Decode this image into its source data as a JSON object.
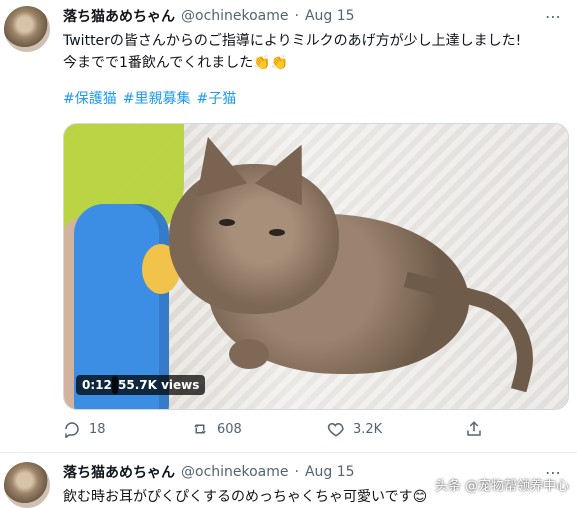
{
  "tweets": [
    {
      "author": {
        "name": "落ち猫あめちゃん",
        "handle": "@ochinekoame",
        "sep": "·",
        "date": "Aug 15"
      },
      "text_line1": "Twitterの皆さんからのご指導によりミルクのあげ方が少し上達しました!",
      "text_line2": "今までで1番飲んでくれました👏👏",
      "hashtags": [
        "#保護猫",
        "#里親募集",
        "#子猫"
      ],
      "video": {
        "duration": "0:12",
        "views": "55.7K views"
      },
      "actions": {
        "reply": "18",
        "retweet": "608",
        "like": "3.2K"
      }
    },
    {
      "author": {
        "name": "落ち猫あめちゃん",
        "handle": "@ochinekoame",
        "sep": "·",
        "date": "Aug 15"
      },
      "text_line1": "飲む時お耳がぴくぴくするのめっちゃくちゃ可愛いです😊"
    }
  ],
  "watermark": "头条 @宠物帮领养中心",
  "icons": {
    "more": "more-icon",
    "reply": "reply-icon",
    "retweet": "retweet-icon",
    "like": "heart-icon",
    "share": "share-icon"
  }
}
